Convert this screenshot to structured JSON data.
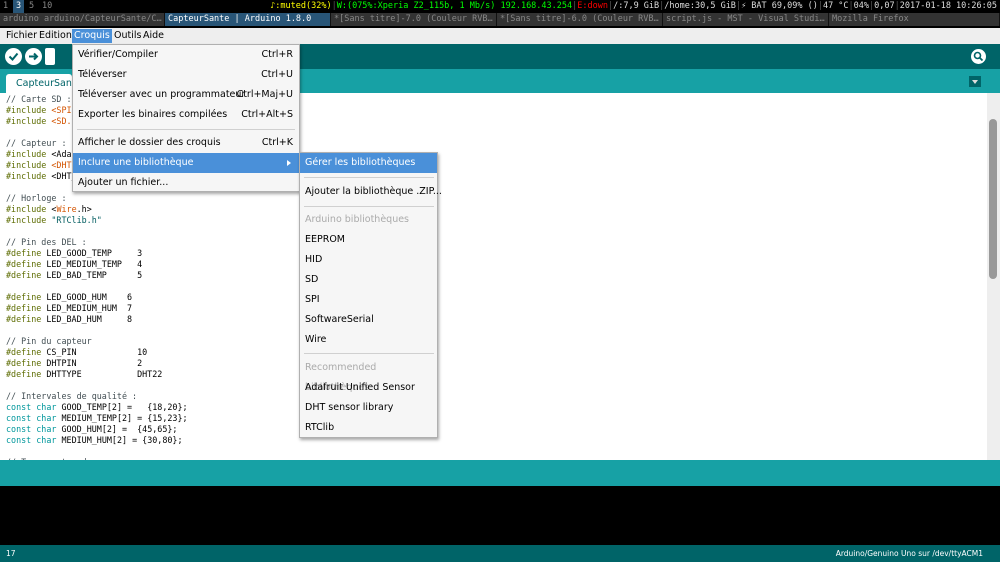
{
  "i3bar": {
    "workspaces": [
      "1",
      "3",
      "5",
      "10"
    ],
    "focused_workspace": "3",
    "status": {
      "audio": "♪:muted(32%)",
      "wifi": "W:(075%:Xperia Z2_115b, 1 Mb/s) 192.168.43.254",
      "eth": "E:down",
      "disk_root": "/:7,9 GiB",
      "disk_home": "/home:30,5 GiB",
      "battery": "⚡ BAT 69,09% ()",
      "temp": "47 °C",
      "cpu": "04%",
      "load": "0,07",
      "datetime": "2017-01-18 10:26:05"
    },
    "colors": {
      "focused_bg": "#285577",
      "wifi": "#00ff00",
      "eth": "#ff0000"
    }
  },
  "window_tabs": [
    {
      "label": "arduino arduino/CapteurSante/C…",
      "active": false
    },
    {
      "label": "CapteurSante | Arduino 1.8.0",
      "active": true
    },
    {
      "label": "*[Sans titre]-7.0 (Couleur RVB…",
      "active": false
    },
    {
      "label": "*[Sans titre]-6.0 (Couleur RVB…",
      "active": false
    },
    {
      "label": "script.js - MST - Visual Studi…",
      "active": false
    },
    {
      "label": "Mozilla Firefox",
      "active": false
    }
  ],
  "menubar": {
    "items": [
      "Fichier",
      "Edition",
      "Croquis",
      "Outils",
      "Aide"
    ],
    "open": "Croquis"
  },
  "toolbar": {
    "buttons": [
      "verify-icon",
      "upload-icon",
      "new-icon",
      "open-icon",
      "save-icon"
    ],
    "search": "serial-monitor-icon"
  },
  "editor": {
    "tab_label": "CapteurSante",
    "code_lines": [
      [
        {
          "t": "// Carte SD :",
          "c": "cm"
        }
      ],
      [
        {
          "t": "#include ",
          "c": "kw"
        },
        {
          "t": "<SPI.h>",
          "c": "lib"
        }
      ],
      [
        {
          "t": "#include ",
          "c": "kw"
        },
        {
          "t": "<SD.h>",
          "c": "lib"
        }
      ],
      [
        {
          "t": "",
          "c": ""
        }
      ],
      [
        {
          "t": "// Capteur :",
          "c": "cm"
        }
      ],
      [
        {
          "t": "#include ",
          "c": "kw"
        },
        {
          "t": "<Adafruit_Sensor.h>",
          "c": ""
        }
      ],
      [
        {
          "t": "#include ",
          "c": "kw"
        },
        {
          "t": "<DHT.h>",
          "c": "lib"
        }
      ],
      [
        {
          "t": "#include ",
          "c": "kw"
        },
        {
          "t": "<DHT_U.h>",
          "c": ""
        }
      ],
      [
        {
          "t": "",
          "c": ""
        }
      ],
      [
        {
          "t": "// Horloge :",
          "c": "cm"
        }
      ],
      [
        {
          "t": "#include ",
          "c": "kw"
        },
        {
          "t": "<",
          "c": ""
        },
        {
          "t": "Wire",
          "c": "lib"
        },
        {
          "t": ".h>",
          "c": ""
        }
      ],
      [
        {
          "t": "#include ",
          "c": "kw"
        },
        {
          "t": "\"RTClib.h\"",
          "c": "st"
        }
      ],
      [
        {
          "t": "",
          "c": ""
        }
      ],
      [
        {
          "t": "// Pin des DEL :",
          "c": "cm"
        }
      ],
      [
        {
          "t": "#define ",
          "c": "kw"
        },
        {
          "t": "LED_GOOD_TEMP     3",
          "c": ""
        }
      ],
      [
        {
          "t": "#define ",
          "c": "kw"
        },
        {
          "t": "LED_MEDIUM_TEMP   4",
          "c": ""
        }
      ],
      [
        {
          "t": "#define ",
          "c": "kw"
        },
        {
          "t": "LED_BAD_TEMP      5",
          "c": ""
        }
      ],
      [
        {
          "t": "",
          "c": ""
        }
      ],
      [
        {
          "t": "#define ",
          "c": "kw"
        },
        {
          "t": "LED_GOOD_HUM    6",
          "c": ""
        }
      ],
      [
        {
          "t": "#define ",
          "c": "kw"
        },
        {
          "t": "LED_MEDIUM_HUM  7",
          "c": ""
        }
      ],
      [
        {
          "t": "#define ",
          "c": "kw"
        },
        {
          "t": "LED_BAD_HUM     8",
          "c": ""
        }
      ],
      [
        {
          "t": "",
          "c": ""
        }
      ],
      [
        {
          "t": "// Pin du capteur",
          "c": "cm"
        }
      ],
      [
        {
          "t": "#define ",
          "c": "kw"
        },
        {
          "t": "CS_PIN            10",
          "c": ""
        }
      ],
      [
        {
          "t": "#define ",
          "c": "kw"
        },
        {
          "t": "DHTPIN            2",
          "c": ""
        }
      ],
      [
        {
          "t": "#define ",
          "c": "kw"
        },
        {
          "t": "DHTTYPE           DHT22",
          "c": ""
        }
      ],
      [
        {
          "t": "",
          "c": ""
        }
      ],
      [
        {
          "t": "// Intervales de qualité :",
          "c": "cm"
        }
      ],
      [
        {
          "t": "const ",
          "c": "ty"
        },
        {
          "t": "char ",
          "c": "ty"
        },
        {
          "t": "GOOD_TEMP[2] =   {18,20};",
          "c": ""
        }
      ],
      [
        {
          "t": "const ",
          "c": "ty"
        },
        {
          "t": "char ",
          "c": "ty"
        },
        {
          "t": "MEDIUM_TEMP[2] = {15,23};",
          "c": ""
        }
      ],
      [
        {
          "t": "const ",
          "c": "ty"
        },
        {
          "t": "char ",
          "c": "ty"
        },
        {
          "t": "GOOD_HUM[2] =  {45,65};",
          "c": ""
        }
      ],
      [
        {
          "t": "const ",
          "c": "ty"
        },
        {
          "t": "char ",
          "c": "ty"
        },
        {
          "t": "MEDIUM_HUM[2] = {30,80};",
          "c": ""
        }
      ],
      [
        {
          "t": "",
          "c": ""
        }
      ],
      [
        {
          "t": "// Temps entre deux mesures",
          "c": "cm"
        }
      ]
    ]
  },
  "croquis_menu": [
    {
      "label": "Vérifier/Compiler",
      "shortcut": "Ctrl+R"
    },
    {
      "label": "Téléverser",
      "shortcut": "Ctrl+U"
    },
    {
      "label": "Téléverser avec un programmateur",
      "shortcut": "Ctrl+Maj+U"
    },
    {
      "label": "Exporter les binaires compilées",
      "shortcut": "Ctrl+Alt+S"
    },
    {
      "label": "Afficher le dossier des croquis",
      "shortcut": "Ctrl+K"
    },
    {
      "label": "Inclure une bibliothèque",
      "shortcut": ""
    },
    {
      "label": "Ajouter un fichier...",
      "shortcut": ""
    }
  ],
  "library_menu": {
    "manage": "Gérer les bibliothèques",
    "add_zip": "Ajouter la bibliothèque .ZIP...",
    "arduino_header": "Arduino bibliothèques",
    "arduino_libs": [
      "EEPROM",
      "HID",
      "SD",
      "SPI",
      "SoftwareSerial",
      "Wire"
    ],
    "recommended_header": "Recommended bibliothèques",
    "recommended_libs": [
      "Adafruit Unified Sensor",
      "DHT sensor library",
      "RTClib"
    ]
  },
  "status": {
    "line": "17",
    "board": "Arduino/Genuino Uno sur /dev/ttyACM1"
  },
  "colors": {
    "arduino_dark": "#006468",
    "arduino_light": "#17a1a5",
    "menu_highlight": "#4a90d9"
  }
}
